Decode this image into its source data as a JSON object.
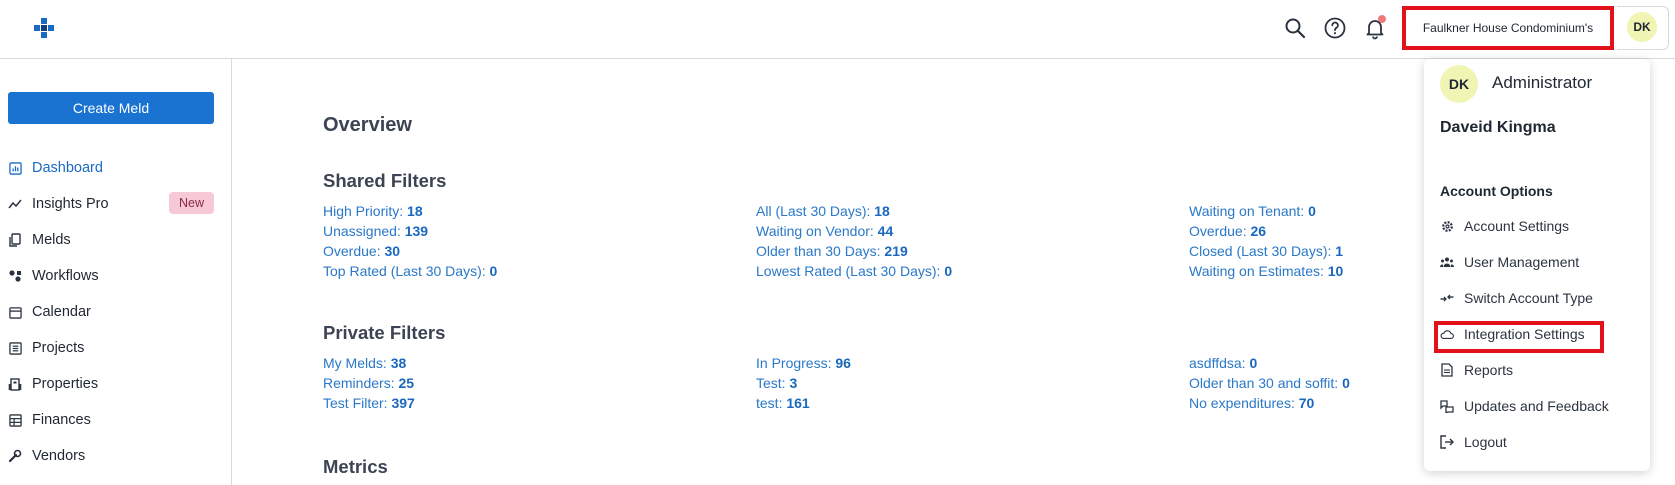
{
  "header": {
    "account_name": "Faulkner House Condominium's",
    "user_initials": "DK",
    "icons": [
      "logo-icon",
      "search-icon",
      "help-icon",
      "bell-icon"
    ],
    "notification_dot_color": "#f07a7a",
    "highlight_color": "#e3121a"
  },
  "sidebar": {
    "create_button": "Create Meld",
    "items": [
      {
        "label": "Dashboard",
        "icon": "dashboard-icon",
        "active": true
      },
      {
        "label": "Insights Pro",
        "icon": "insights-icon",
        "badge": "New"
      },
      {
        "label": "Melds",
        "icon": "melds-icon"
      },
      {
        "label": "Workflows",
        "icon": "workflows-icon"
      },
      {
        "label": "Calendar",
        "icon": "calendar-icon"
      },
      {
        "label": "Projects",
        "icon": "projects-icon"
      },
      {
        "label": "Properties",
        "icon": "properties-icon"
      },
      {
        "label": "Finances",
        "icon": "finances-icon"
      },
      {
        "label": "Vendors",
        "icon": "vendors-icon"
      }
    ]
  },
  "main": {
    "overview_title": "Overview",
    "shared_title": "Shared Filters",
    "shared": [
      {
        "label": "High Priority:",
        "count": "18"
      },
      {
        "label": "Unassigned:",
        "count": "139"
      },
      {
        "label": "Overdue:",
        "count": "30"
      },
      {
        "label": "Top Rated (Last 30 Days):",
        "count": "0"
      },
      {
        "label": "All (Last 30 Days):",
        "count": "18"
      },
      {
        "label": "Waiting on Vendor:",
        "count": "44"
      },
      {
        "label": "Older than 30 Days:",
        "count": "219"
      },
      {
        "label": "Lowest Rated (Last 30 Days):",
        "count": "0"
      },
      {
        "label": "Waiting on Tenant:",
        "count": "0"
      },
      {
        "label": "Overdue:",
        "count": "26"
      },
      {
        "label": "Closed (Last 30 Days):",
        "count": "1"
      },
      {
        "label": "Waiting on Estimates:",
        "count": "10"
      }
    ],
    "private_title": "Private Filters",
    "private": [
      {
        "label": "My Melds:",
        "count": "38"
      },
      {
        "label": "Reminders:",
        "count": "25"
      },
      {
        "label": "Test Filter:",
        "count": "397"
      },
      {
        "label": "In Progress:",
        "count": "96"
      },
      {
        "label": "Test:",
        "count": "3"
      },
      {
        "label": "test:",
        "count": "161"
      },
      {
        "label": "asdffdsa:",
        "count": "0"
      },
      {
        "label": "Older than 30 and soffit:",
        "count": "0"
      },
      {
        "label": "No expenditures:",
        "count": "70"
      }
    ],
    "metrics_title": "Metrics"
  },
  "dropdown": {
    "initials": "DK",
    "role": "Administrator",
    "name": "Daveid Kingma",
    "options_title": "Account Options",
    "items": [
      {
        "label": "Account Settings",
        "icon": "gear-icon"
      },
      {
        "label": "User Management",
        "icon": "users-icon"
      },
      {
        "label": "Switch Account Type",
        "icon": "switch-icon"
      },
      {
        "label": "Integration Settings",
        "icon": "cloud-icon",
        "highlighted": true
      },
      {
        "label": "Reports",
        "icon": "document-icon"
      },
      {
        "label": "Updates and Feedback",
        "icon": "feedback-icon"
      },
      {
        "label": "Logout",
        "icon": "logout-icon"
      }
    ]
  }
}
